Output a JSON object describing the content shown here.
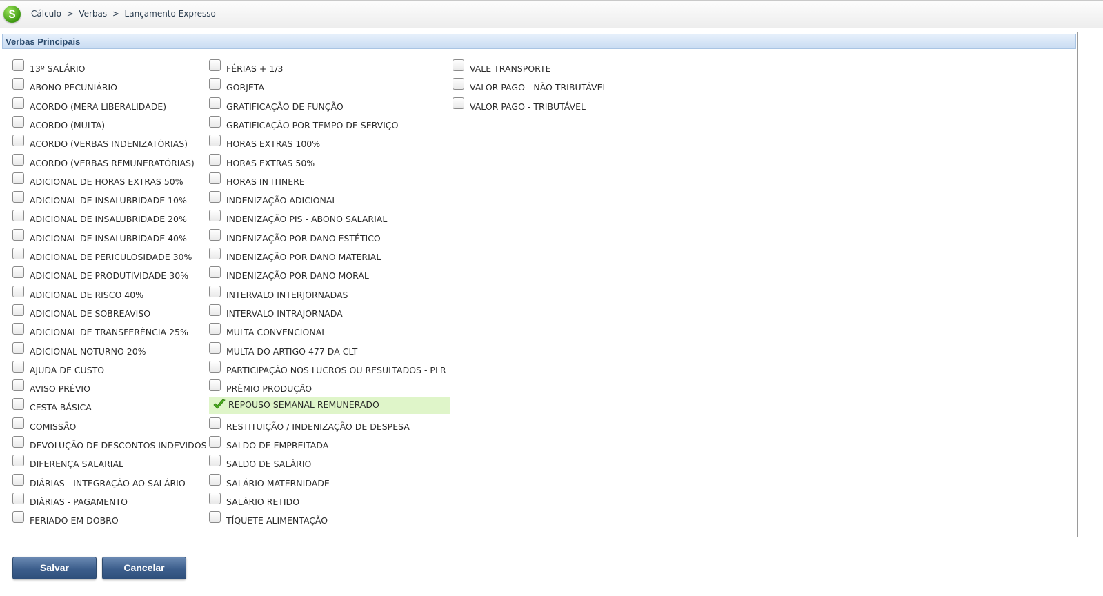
{
  "header": {
    "breadcrumb": [
      "Cálculo",
      ">",
      "Verbas",
      ">",
      "Lançamento Expresso"
    ],
    "logo_icon": "dollar-icon",
    "logo_glyph": "$"
  },
  "panel": {
    "title": "Verbas Principais"
  },
  "columns": [
    {
      "items": [
        {
          "label": "13º SALÁRIO",
          "checked": false
        },
        {
          "label": "ABONO PECUNIÁRIO",
          "checked": false
        },
        {
          "label": "ACORDO (MERA LIBERALIDADE)",
          "checked": false
        },
        {
          "label": "ACORDO (MULTA)",
          "checked": false
        },
        {
          "label": "ACORDO (VERBAS INDENIZATÓRIAS)",
          "checked": false
        },
        {
          "label": "ACORDO (VERBAS REMUNERATÓRIAS)",
          "checked": false
        },
        {
          "label": "ADICIONAL DE HORAS EXTRAS 50%",
          "checked": false
        },
        {
          "label": "ADICIONAL DE INSALUBRIDADE 10%",
          "checked": false
        },
        {
          "label": "ADICIONAL DE INSALUBRIDADE 20%",
          "checked": false
        },
        {
          "label": "ADICIONAL DE INSALUBRIDADE 40%",
          "checked": false
        },
        {
          "label": "ADICIONAL DE PERICULOSIDADE 30%",
          "checked": false
        },
        {
          "label": "ADICIONAL DE PRODUTIVIDADE 30%",
          "checked": false
        },
        {
          "label": "ADICIONAL DE RISCO 40%",
          "checked": false
        },
        {
          "label": "ADICIONAL DE SOBREAVISO",
          "checked": false
        },
        {
          "label": "ADICIONAL DE TRANSFERÊNCIA 25%",
          "checked": false
        },
        {
          "label": "ADICIONAL NOTURNO 20%",
          "checked": false
        },
        {
          "label": "AJUDA DE CUSTO",
          "checked": false
        },
        {
          "label": "AVISO PRÉVIO",
          "checked": false
        },
        {
          "label": "CESTA BÁSICA",
          "checked": false
        },
        {
          "label": "COMISSÃO",
          "checked": false
        },
        {
          "label": "DEVOLUÇÃO DE DESCONTOS INDEVIDOS",
          "checked": false
        },
        {
          "label": "DIFERENÇA SALARIAL",
          "checked": false
        },
        {
          "label": "DIÁRIAS - INTEGRAÇÃO AO SALÁRIO",
          "checked": false
        },
        {
          "label": "DIÁRIAS - PAGAMENTO",
          "checked": false
        },
        {
          "label": "FERIADO EM DOBRO",
          "checked": false
        }
      ]
    },
    {
      "items": [
        {
          "label": "FÉRIAS + 1/3",
          "checked": false
        },
        {
          "label": "GORJETA",
          "checked": false
        },
        {
          "label": "GRATIFICAÇÃO DE FUNÇÃO",
          "checked": false
        },
        {
          "label": "GRATIFICAÇÃO POR TEMPO DE SERVIÇO",
          "checked": false
        },
        {
          "label": "HORAS EXTRAS 100%",
          "checked": false
        },
        {
          "label": "HORAS EXTRAS 50%",
          "checked": false
        },
        {
          "label": "HORAS IN ITINERE",
          "checked": false
        },
        {
          "label": "INDENIZAÇÃO ADICIONAL",
          "checked": false
        },
        {
          "label": "INDENIZAÇÃO PIS - ABONO SALARIAL",
          "checked": false
        },
        {
          "label": "INDENIZAÇÃO POR DANO ESTÉTICO",
          "checked": false
        },
        {
          "label": "INDENIZAÇÃO POR DANO MATERIAL",
          "checked": false
        },
        {
          "label": "INDENIZAÇÃO POR DANO MORAL",
          "checked": false
        },
        {
          "label": "INTERVALO INTERJORNADAS",
          "checked": false
        },
        {
          "label": "INTERVALO INTRAJORNADA",
          "checked": false
        },
        {
          "label": "MULTA CONVENCIONAL",
          "checked": false
        },
        {
          "label": "MULTA DO ARTIGO 477 DA CLT",
          "checked": false
        },
        {
          "label": "PARTICIPAÇÃO NOS LUCROS OU RESULTADOS - PLR",
          "checked": false
        },
        {
          "label": "PRÊMIO PRODUÇÃO",
          "checked": false
        },
        {
          "label": "REPOUSO SEMANAL REMUNERADO",
          "checked": true
        },
        {
          "label": "RESTITUIÇÃO / INDENIZAÇÃO DE DESPESA",
          "checked": false
        },
        {
          "label": "SALDO DE EMPREITADA",
          "checked": false
        },
        {
          "label": "SALDO DE SALÁRIO",
          "checked": false
        },
        {
          "label": "SALÁRIO MATERNIDADE",
          "checked": false
        },
        {
          "label": "SALÁRIO RETIDO",
          "checked": false
        },
        {
          "label": "TÍQUETE-ALIMENTAÇÃO",
          "checked": false
        }
      ]
    },
    {
      "items": [
        {
          "label": "VALE TRANSPORTE",
          "checked": false
        },
        {
          "label": "VALOR PAGO - NÃO TRIBUTÁVEL",
          "checked": false
        },
        {
          "label": "VALOR PAGO - TRIBUTÁVEL",
          "checked": false
        }
      ]
    }
  ],
  "buttons": {
    "save_label": "Salvar",
    "cancel_label": "Cancelar"
  },
  "colors": {
    "accent_button": "#3c5e8c",
    "selected_row": "#dff5c9",
    "check_green": "#4caf1f",
    "panel_header": "#c9dcf2"
  }
}
